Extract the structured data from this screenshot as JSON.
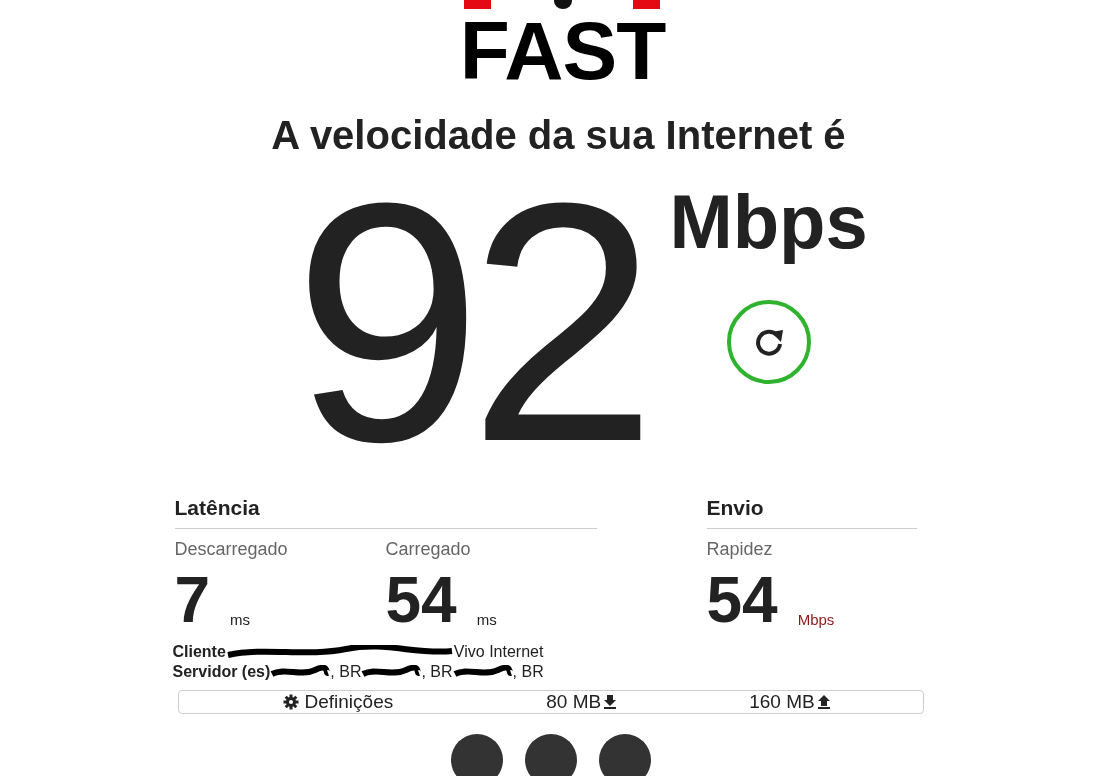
{
  "logo": {
    "text": "FAST"
  },
  "headline": "A velocidade da sua Internet é",
  "speed": {
    "value": "92",
    "unit": "Mbps"
  },
  "latency": {
    "title": "Latência",
    "items": [
      {
        "label": "Descarregado",
        "value": "7",
        "unit": "ms"
      },
      {
        "label": "Carregado",
        "value": "54",
        "unit": "ms"
      }
    ]
  },
  "upload": {
    "title": "Envio",
    "items": [
      {
        "label": "Rapidez",
        "value": "54",
        "unit": "Mbps"
      }
    ]
  },
  "client": {
    "label": "Cliente",
    "tail": "Vivo Internet"
  },
  "servers": {
    "label": "Servidor (es)",
    "parts": [
      ", BR",
      ", BR",
      ", BR"
    ]
  },
  "footer": {
    "settings": "Definições",
    "download": {
      "value": "80",
      "unit": "MB"
    },
    "upload": {
      "value": "160",
      "unit": "MB"
    }
  }
}
